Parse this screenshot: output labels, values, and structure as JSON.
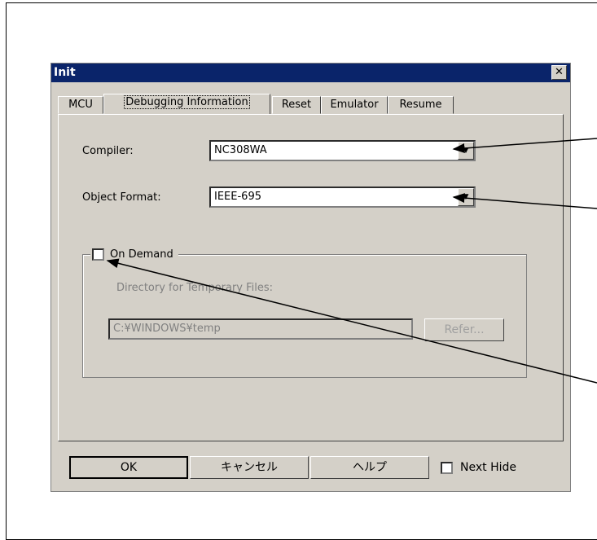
{
  "dialog": {
    "title": "Init",
    "close_glyph": "✕",
    "tabs": [
      {
        "label": "MCU",
        "active": false
      },
      {
        "label": "Debugging Information",
        "active": true
      },
      {
        "label": "Reset",
        "active": false
      },
      {
        "label": "Emulator",
        "active": false
      },
      {
        "label": "Resume",
        "active": false
      }
    ],
    "compiler": {
      "label": "Compiler:",
      "value": "NC308WA"
    },
    "object_format": {
      "label": "Object Format:",
      "value": "IEEE-695"
    },
    "on_demand": {
      "label": "On Demand",
      "checked": false,
      "dir_label": "Directory for Temporary Files:",
      "dir_value": "C:¥WINDOWS¥temp",
      "refer_label": "Refer..."
    },
    "buttons": {
      "ok": "OK",
      "cancel": "キャンセル",
      "help": "ヘルプ"
    },
    "next_hide": {
      "label": "Next Hide",
      "checked": false
    }
  }
}
